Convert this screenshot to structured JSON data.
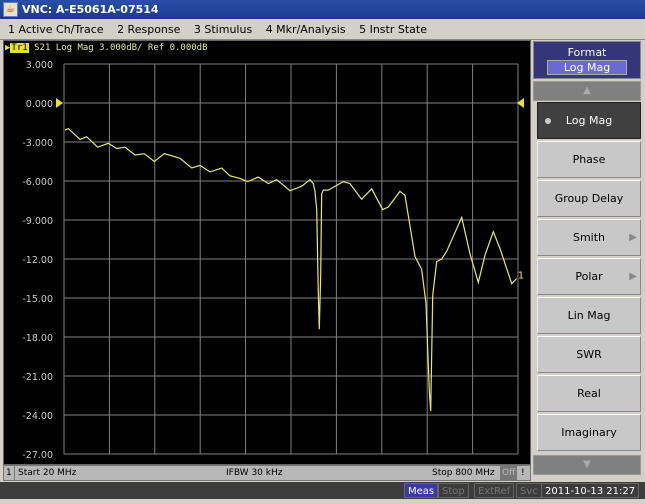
{
  "window": {
    "title": "VNC: A-E5061A-07514"
  },
  "menu": [
    "1 Active Ch/Trace",
    "2 Response",
    "3 Stimulus",
    "4 Mkr/Analysis",
    "5 Instr State"
  ],
  "trace": {
    "label": "Tr1",
    "param": "S21 Log Mag 3.000dB/ Ref 0.000dB",
    "marker_label": "1"
  },
  "colors": {
    "trace": "#e8e870",
    "grid": "#808080",
    "background": "#000000",
    "accent": "#35357a"
  },
  "chart_data": {
    "type": "line",
    "ylim": [
      -27,
      3
    ],
    "xlim_mhz": [
      20,
      800
    ],
    "y_ticks": [
      "3.000",
      "0.000",
      "-3.000",
      "-6.000",
      "-9.000",
      "-12.00",
      "-15.00",
      "-18.00",
      "-21.00",
      "-24.00",
      "-27.00"
    ],
    "reference_db": 0,
    "grid": true,
    "series": [
      {
        "x_mhz": [
          21.7,
          27.4,
          47.5,
          59,
          77.9,
          96.1,
          110.5,
          124.8,
          142,
          158,
          175.1,
          192.3,
          219.3,
          239.4,
          253.6,
          270.8,
          290.9,
          305.2,
          322.4,
          335.6,
          353.8,
          371,
          385.4,
          408.3,
          428.4,
          442.6,
          448.3,
          451.2,
          454.2,
          456.9,
          458.6,
          461,
          462.7,
          465.5,
          474.1,
          499.8,
          511.3,
          531.4,
          548.6,
          567.5,
          577.1,
          597.2,
          605.8,
          623,
          634.5,
          641.9,
          647.6,
          650,
          653.5,
          660.3,
          668.9,
          677.5,
          703.3,
          717.5,
          731.8,
          743.3,
          757.6,
          769.1,
          789.2,
          797.8
        ],
        "y_db": [
          -2.08,
          -1.97,
          -2.8,
          -2.6,
          -3.4,
          -3.1,
          -3.5,
          -3.4,
          -4.0,
          -3.9,
          -4.5,
          -3.9,
          -4.25,
          -5.0,
          -4.8,
          -5.3,
          -5.0,
          -5.6,
          -5.8,
          -6.05,
          -5.7,
          -6.2,
          -5.9,
          -6.75,
          -6.4,
          -5.9,
          -6.2,
          -6.8,
          -8.2,
          -14.6,
          -17.4,
          -13.3,
          -7.0,
          -6.7,
          -6.7,
          -6.05,
          -6.2,
          -7.4,
          -6.6,
          -8.2,
          -8.0,
          -6.8,
          -7.1,
          -11.8,
          -12.8,
          -15.4,
          -22.1,
          -23.7,
          -14.8,
          -12.2,
          -12.0,
          -11.4,
          -8.8,
          -11.6,
          -13.8,
          -11.7,
          -9.9,
          -11.2,
          -13.9,
          -13.5
        ]
      }
    ]
  },
  "status": {
    "channel": "1",
    "start": "Start 20 MHz",
    "ifbw": "IFBW 30 kHz",
    "stop": "Stop 800 MHz",
    "off": "Off",
    "warn": "!"
  },
  "bottom": {
    "meas": "Meas",
    "stop": "Stop",
    "extref": "ExtRef",
    "svc": "Svc",
    "datetime": "2011-10-13 21:27"
  },
  "softkeys": {
    "header": "Format",
    "current": "Log Mag",
    "items": [
      {
        "label": "Log Mag",
        "selected": true
      },
      {
        "label": "Phase"
      },
      {
        "label": "Group Delay"
      },
      {
        "label": "Smith",
        "submenu": true
      },
      {
        "label": "Polar",
        "submenu": true
      },
      {
        "label": "Lin Mag"
      },
      {
        "label": "SWR"
      },
      {
        "label": "Real"
      },
      {
        "label": "Imaginary"
      }
    ],
    "up_icon": "triangle-up",
    "down_icon": "triangle-down"
  }
}
